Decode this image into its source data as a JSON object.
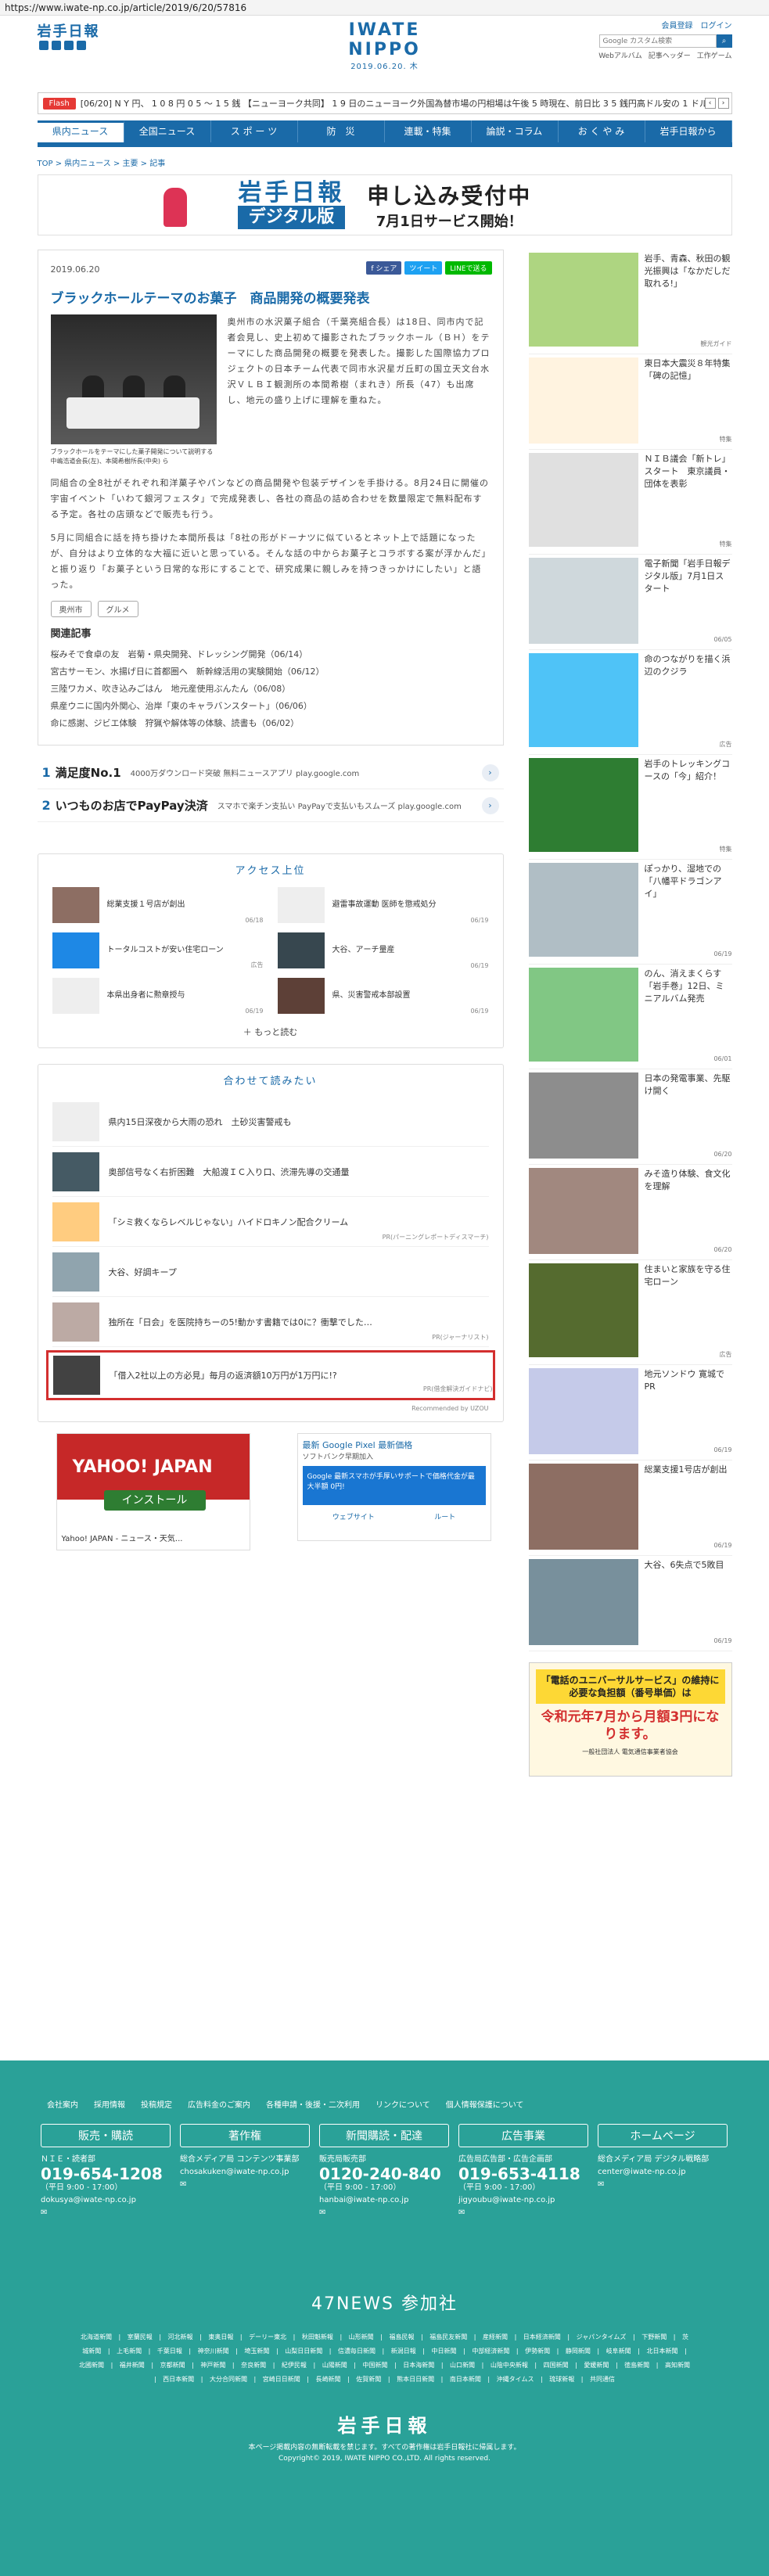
{
  "url": "https://www.iwate-np.co.jp/article/2019/6/20/57816",
  "header": {
    "logo_small": "岩手日報",
    "brand": "IWATE NIPPO",
    "date": "2019.06.20. 木",
    "links": [
      "会員登録",
      "ログイン"
    ],
    "search_placeholder": "Google カスタム検索",
    "hlinks": [
      "Webアルバム",
      "記事ヘッダー",
      "工作ゲーム"
    ]
  },
  "flash": {
    "tag": "Flash",
    "text": "[06/20] N Y 円、 1 0 8 円 0 5 ～ 1 5 銭 【ニューヨーク共同】 1 9 日のニューヨーク外国為替市場の円相場は午後 5 時現在、前日比 3 5 銭円高ドル安の 1 ドル＝ 1 0 ～"
  },
  "nav": [
    "県内ニュース",
    "全国ニュース",
    "ス ポ ー ツ",
    "防　災",
    "連載・特集",
    "論説・コラム",
    "お く や み",
    "岩手日報から"
  ],
  "crumb": "TOP > 県内ニュース > 主要 > 記事",
  "banner": {
    "logo": "岩手日報",
    "sub": "デジタル版",
    "main": "申し込み受付中",
    "date": "7月1日サービス開始！"
  },
  "article": {
    "date": "2019.06.20",
    "title": "ブラックホールテーマのお菓子　商品開発の概要発表",
    "share": [
      "f シェア",
      "ツイート",
      "LINEで送る"
    ],
    "caption": "ブラックホールをテーマにした菓子開発について説明する中嶋浩道会長(左)、本間希樹所長(中央) ら",
    "p1": "奥州市の水沢菓子組合（千葉亮組合長）は18日、同市内で記者会見し、史上初めて撮影されたブラックホール（ＢＨ）をテーマにした商品開発の概要を発表した。撮影した国際協力プロジェクトの日本チーム代表で同市水沢星ガ丘町の国立天文台水沢ＶＬＢＩ観測所の本間希樹（まれき）所長（47）も出席し、地元の盛り上げに理解を重ねた。",
    "p2": "同組合の全8社がそれぞれ和洋菓子やパンなどの商品開発や包装デザインを手掛ける。8月24日に開催の宇宙イベント「いわて銀河フェスタ」で完成発表し、各社の商品の詰め合わせを数量限定で無料配布する予定。各社の店頭などで販売も行う。",
    "p3": "5月に同組合に話を持ち掛けた本間所長は「8社の形がドーナツに似ているとネット上で話題になったが、自分はより立体的な大福に近いと思っている。そんな話の中からお菓子とコラボする案が浮かんだ」と振り返り「お菓子という日常的な形にすることで、研究成果に親しみを持つきっかけにしたい」と語った。",
    "tags": [
      "奥州市",
      "グルメ"
    ],
    "related_heading": "関連記事",
    "related": [
      "桜みそで食卓の友　岩菊・県央開発、ドレッシング開発（06/14）",
      "宮古サーモン、水揚げ日に首都圏へ　新幹線活用の実験開始（06/12）",
      "三陸ワカメ、吹き込みごはん　地元産使用ぶんたん（06/08）",
      "県産ウニに国内外関心、治岸「東のキャラバンスタート」（06/06）",
      "命に感謝、ジビエ体験　狩猟や解体等の体験、読書も（06/02）"
    ]
  },
  "text_ads": [
    {
      "num": "1",
      "title": "満足度No.1",
      "desc": "4000万ダウンロード突破 無料ニュースアプリ play.google.com"
    },
    {
      "num": "2",
      "title": "いつものお店でPayPay決済",
      "desc": "スマホで楽チン支払い PayPayで支払いもスムーズ play.google.com"
    }
  ],
  "ranking": {
    "heading": "アクセス上位",
    "items": [
      {
        "text": "総業支援１号店が創出",
        "date": "06/18"
      },
      {
        "text": "避雷事故運動 医師を懲戒処分",
        "date": "06/19"
      },
      {
        "text": "トータルコストが安い住宅ローン",
        "date": "広告"
      },
      {
        "text": "大谷、アーチ量産",
        "date": "06/19"
      },
      {
        "text": "本県出身者に勲章授与",
        "date": "06/19"
      },
      {
        "text": "県、災害警戒本部設置",
        "date": "06/19"
      }
    ],
    "more": "＋ もっと読む"
  },
  "recommend": {
    "heading": "合わせて読みたい",
    "items": [
      {
        "text": "県内15日深夜から大雨の恐れ　土砂災害警戒も",
        "pr": ""
      },
      {
        "text": "奥部信号なく右折困難　大船渡ＩＣ入り口、渋滞先導の交通量",
        "pr": ""
      },
      {
        "text": "「シミ救くならレベルじゃない」ハイドロキノン配合クリーム",
        "pr": "PR(パーニングレポートディスマーチ)"
      },
      {
        "text": "大谷、好調キープ",
        "pr": ""
      },
      {
        "text": "独所在「日会」を医院持ちーの5!動かす書籍では0に？衝撃でした…",
        "pr": "PR(ジャーナリスト)"
      },
      {
        "text": "「借入2社以上の方必見」毎月の返済額10万円が1万円に!?",
        "pr": "PR(借金解決ガイドナビ)"
      }
    ],
    "by": "Recommended by UZOU"
  },
  "bottom_ads": {
    "yahoo_logo": "YAHOO! JAPAN",
    "install": "インストール",
    "yahoo_sub": "Yahoo! JAPAN - ニュース・天気...",
    "gp_title": "最新 Google Pixel 最新価格",
    "gp_sub": "ソフトバンク早期加入",
    "gp_box": "Google 最新スマホが手厚いサポートで価格代金が最大半額 0円!",
    "gp_links": [
      "ウェブサイト",
      "ルート"
    ]
  },
  "sidebar": [
    {
      "text": "岩手、青森、秋田の観光振興は「なかだしだ取れる!」",
      "date": "観光ガイド"
    },
    {
      "text": "東日本大震災８年特集「碑の記憶」",
      "date": "特集"
    },
    {
      "text": "ＮＩＢ議会「新トレ」スタート　東京議員・団体を表彰",
      "date": "特集"
    },
    {
      "text": "電子新聞「岩手日報デジタル版」7月1日スタート",
      "date": "06/05"
    },
    {
      "text": "命のつながりを描く浜辺のクジラ",
      "date": "広告"
    },
    {
      "text": "岩手のトレッキングコースの「今」紹介！",
      "date": "特集"
    },
    {
      "text": "ぽっかり、湿地での「八幡平ドラゴンアイ」",
      "date": "06/19"
    },
    {
      "text": "のん、消えまくらす「岩手巻」12日、ミニアルバム発売",
      "date": "06/01"
    },
    {
      "text": "日本の発電事業、先駆け開く",
      "date": "06/20"
    },
    {
      "text": "みそ造り体験、食文化を理解",
      "date": "06/20"
    },
    {
      "text": "住まいと家族を守る住宅ローン",
      "date": "広告"
    },
    {
      "text": "地元ソンドウ 寛城でPR",
      "date": "06/19"
    },
    {
      "text": "総業支援1号店が創出",
      "date": "06/19"
    },
    {
      "text": "大谷、6失点で5敗目",
      "date": "06/19"
    }
  ],
  "side_ad": {
    "top": "「電話のユニバーサルサービス」の維持に必要な負担額（番号単価）は",
    "big": "令和元年7月から月額3円になります。",
    "small": "一般社団法人 電気通信事業者協会"
  },
  "footer": {
    "nav": [
      "会社案内",
      "採用情報",
      "投稿規定",
      "広告料金のご案内",
      "各種申請・後援・二次利用",
      "リンクについて",
      "個人情報保護について"
    ],
    "cols": [
      {
        "head": "販売・購読",
        "body": "ＮＩＥ・読者部",
        "phone": "019-654-1208",
        "hours": "（平日 9:00 - 17:00）",
        "mail": "dokusya@iwate-np.co.jp"
      },
      {
        "head": "著作権",
        "body": "総合メディア局 コンテンツ事業部",
        "phone": "",
        "hours": "",
        "mail": "chosakuken@iwate-np.co.jp"
      },
      {
        "head": "新聞購読・配達",
        "body": "販売局販売部",
        "phone": "0120-240-840",
        "hours": "（平日 9:00 - 17:00）",
        "mail": "hanbai@iwate-np.co.jp"
      },
      {
        "head": "広告事業",
        "body": "広告局広告部・広告企画部",
        "phone": "019-653-4118",
        "hours": "（平日 9:00 - 17:00）",
        "mail": "jigyoubu@iwate-np.co.jp"
      },
      {
        "head": "ホームページ",
        "body": "総合メディア局 デジタル戦略部",
        "phone": "",
        "hours": "",
        "mail": "center@iwate-np.co.jp"
      }
    ],
    "news47": "47NEWS 参加社",
    "members": "北海道新聞 | 室蘭民報 | 河北新報 | 東奥日報 | デーリー東北 | 秋田魁新報 | 山形新聞 | 福島民報 | 福島民友新聞 | 産経新聞 | 日本経済新聞 | ジャパンタイムズ | 下野新聞 | 茨城新聞 | 上毛新聞 | 千葉日報 | 神奈川新聞 | 埼玉新聞 | 山梨日日新聞 | 信濃毎日新聞 | 新潟日報 | 中日新聞 | 中部経済新聞 | 伊勢新聞 | 静岡新聞 | 岐阜新聞 | 北日本新聞 | 北國新聞 | 福井新聞 | 京都新聞 | 神戸新聞 | 奈良新聞 | 紀伊民報 | 山陽新聞 | 中国新聞 | 日本海新聞 | 山口新聞 | 山陰中央新報 | 四国新聞 | 愛媛新聞 | 徳島新聞 | 高知新聞 | 西日本新聞 | 大分合同新聞 | 宮崎日日新聞 | 長崎新聞 | 佐賀新聞 | 熊本日日新聞 | 南日本新聞 | 沖縄タイムス | 琉球新報 | 共同通信",
    "logo": "岩手日報",
    "copy1": "本ページ掲載内容の無断転載を禁じます。すべての著作権は岩手日報社に帰属します。",
    "copy2": "Copyright© 2019, IWATE NIPPO CO.,LTD. All rights reserved."
  }
}
